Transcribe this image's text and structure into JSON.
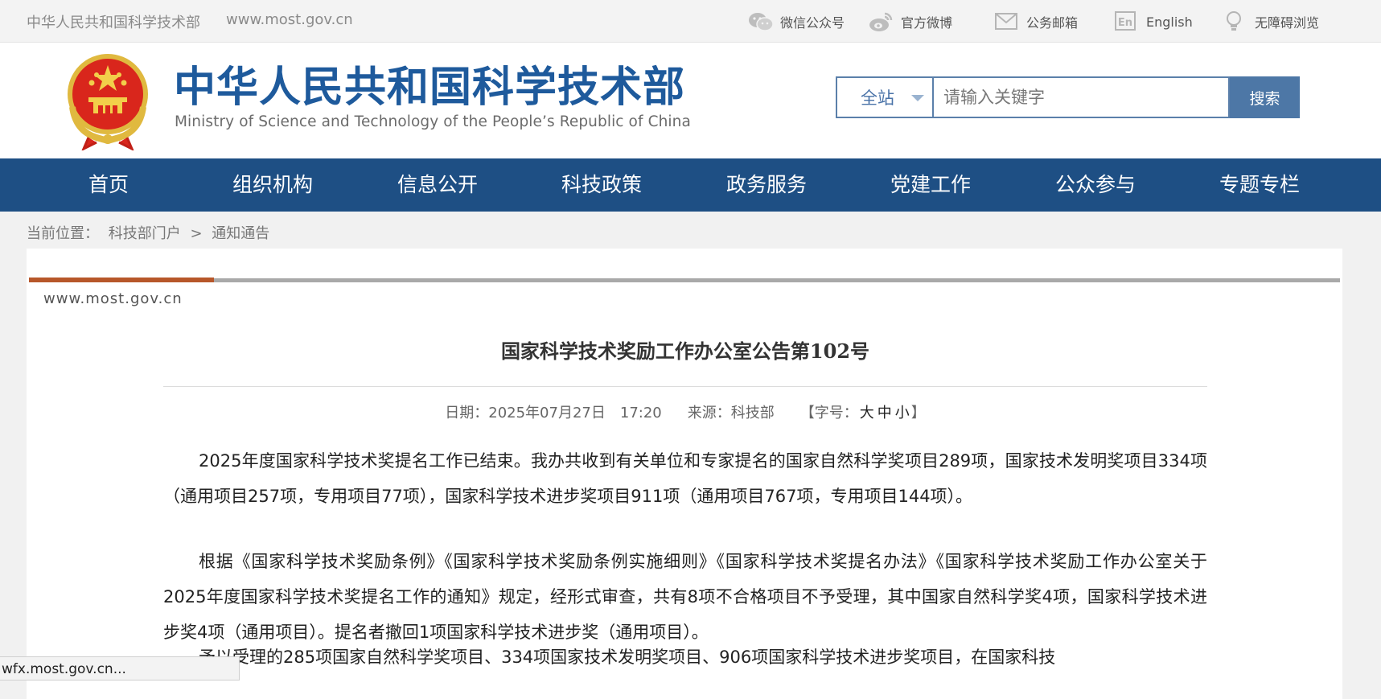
{
  "topbar": {
    "site_name": "中华人民共和国科学技术部",
    "site_url": "www.most.gov.cn",
    "links": [
      {
        "label": "微信公众号",
        "icon": "wechat-icon"
      },
      {
        "label": "官方微博",
        "icon": "weibo-icon"
      },
      {
        "label": "公务邮箱",
        "icon": "mail-icon"
      },
      {
        "label": "English",
        "icon": "english-icon"
      },
      {
        "label": "无障碍浏览",
        "icon": "accessibility-icon"
      }
    ]
  },
  "header": {
    "title_cn": "中华人民共和国科学技术部",
    "title_en": "Ministry of Science and Technology of the People’s Republic of China",
    "emblem_icon": "national-emblem-icon"
  },
  "search": {
    "scope": "全站",
    "placeholder": "请输入关键字",
    "button": "搜索"
  },
  "nav": {
    "items": [
      "首页",
      "组织机构",
      "信息公开",
      "科技政策",
      "政务服务",
      "党建工作",
      "公众参与",
      "专题专栏"
    ]
  },
  "breadcrumb": {
    "label": "当前位置：",
    "items": [
      "科技部门户",
      "通知通告"
    ],
    "separator": ">"
  },
  "article": {
    "site_url": "www.most.gov.cn",
    "title": "国家科学技术奖励工作办公室公告第102号",
    "date": "日期：2025年07月27日　17:20",
    "source": "来源：科技部",
    "font_size_prefix": "【字号：",
    "font_sizes": [
      "大",
      "中",
      "小"
    ],
    "font_size_suffix": "】",
    "paragraphs": [
      "2025年度国家科学技术奖提名工作已结束。我办共收到有关单位和专家提名的国家自然科学奖项目289项，国家技术发明奖项目334项（通用项目257项，专用项目77项），国家科学技术进步奖项目911项（通用项目767项，专用项目144项）。",
      "根据《国家科学技术奖励条例》《国家科学技术奖励条例实施细则》《国家科学技术奖提名办法》《国家科学技术奖励工作办公室关于2025年度国家科学技术奖提名工作的通知》规定，经形式审查，共有8项不合格项目不予受理，其中国家自然科学奖4项，国家科学技术进步奖4项（通用项目）。提名者撤回1项国家科学技术进步奖（通用项目）。",
      "予以受理的285项国家自然科学奖项目、334项国家技术发明奖项目、906项国家科学技术进步奖项目，在国家科技"
    ]
  },
  "statusbar": {
    "text": "wfx.most.gov.cn..."
  },
  "colors": {
    "brand_blue": "#1e4f84",
    "title_blue": "#1e5a9c",
    "accent_orange": "#b7572a",
    "search_button": "#4d77a6"
  }
}
